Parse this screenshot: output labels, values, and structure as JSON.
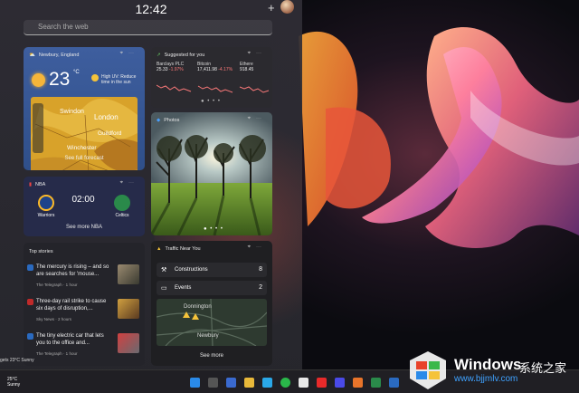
{
  "clock": "12:42",
  "search": {
    "placeholder": "Search the web"
  },
  "weather": {
    "location": "Newbury, England",
    "temp": "23",
    "unit": "°C",
    "alert": "High UV: Reduce time in the sun",
    "places": [
      "Swindon",
      "London",
      "Guildford",
      "Winchester"
    ],
    "forecast_link": "See full forecast"
  },
  "stocks": {
    "title": "Suggested for you",
    "items": [
      {
        "name": "Barclays PLC",
        "value": "25.33",
        "change": "-1.97%"
      },
      {
        "name": "Bitcoin",
        "value": "17,411.98",
        "change": "-4.17%"
      },
      {
        "name": "Ethere",
        "value": "918.45",
        "change": ""
      }
    ]
  },
  "photos": {
    "title": "Photos"
  },
  "nba": {
    "title": "NBA",
    "score": "02:00",
    "home": "Warriors",
    "away": "Celtics",
    "link": "See more NBA"
  },
  "top_stories": {
    "title": "Top stories",
    "items": [
      {
        "title": "The mercury is rising – and so are searches for 'mouse...",
        "source": "The Telegraph · 1 hour"
      },
      {
        "title": "Three-day rail strike to cause six days of disruption,...",
        "source": "Sky News · 2 hours"
      },
      {
        "title": "The tiny electric car that lets you to the office and...",
        "source": "The Telegraph · 1 hour"
      }
    ]
  },
  "traffic": {
    "title": "Traffic Near You",
    "rows": [
      {
        "label": "Constructions",
        "count": "8"
      },
      {
        "label": "Events",
        "count": "2"
      }
    ],
    "map_labels": [
      "Donnington",
      "Newbury"
    ],
    "link": "See more"
  },
  "taskbar": {
    "weather_temp": "25°C",
    "weather_desc": "Sunny"
  },
  "watermark": {
    "brand": "Windows",
    "cn": "系统之家",
    "url": "www.bjjmlv.com"
  },
  "status_text": "gets 23°C Sunny",
  "colors": {
    "accent": "#3f6ab5",
    "alert": "#f87878"
  }
}
